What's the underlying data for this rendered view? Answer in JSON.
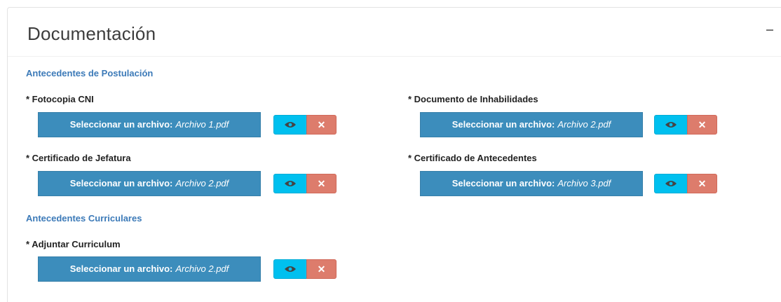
{
  "panel": {
    "title": "Documentación"
  },
  "sections": {
    "postulacion": "Antecedentes de Postulación",
    "curriculares": "Antecedentes Curriculares"
  },
  "fields": {
    "cni": {
      "label": "* Fotocopia CNI",
      "button": "Seleccionar un archivo:",
      "file": "Archivo 1.pdf"
    },
    "inhabilidades": {
      "label": "* Documento de Inhabilidades",
      "button": "Seleccionar un archivo:",
      "file": "Archivo 2.pdf"
    },
    "jefatura": {
      "label": "* Certificado de Jefatura",
      "button": "Seleccionar un archivo:",
      "file": "Archivo 2.pdf"
    },
    "antecedentes": {
      "label": "* Certificado de Antecedentes",
      "button": "Seleccionar un archivo:",
      "file": "Archivo 3.pdf"
    },
    "curriculum": {
      "label": "* Adjuntar Curriculum",
      "button": "Seleccionar un archivo:",
      "file": "Archivo 2.pdf"
    }
  },
  "icons": {
    "view": "eye-icon",
    "delete": "close-icon",
    "collapse": "minus-icon"
  },
  "colors": {
    "file_button": "#3c8dbc",
    "view_button": "#00c0ef",
    "delete_button": "#dd7c6c",
    "section_title": "#3c7ab8"
  }
}
